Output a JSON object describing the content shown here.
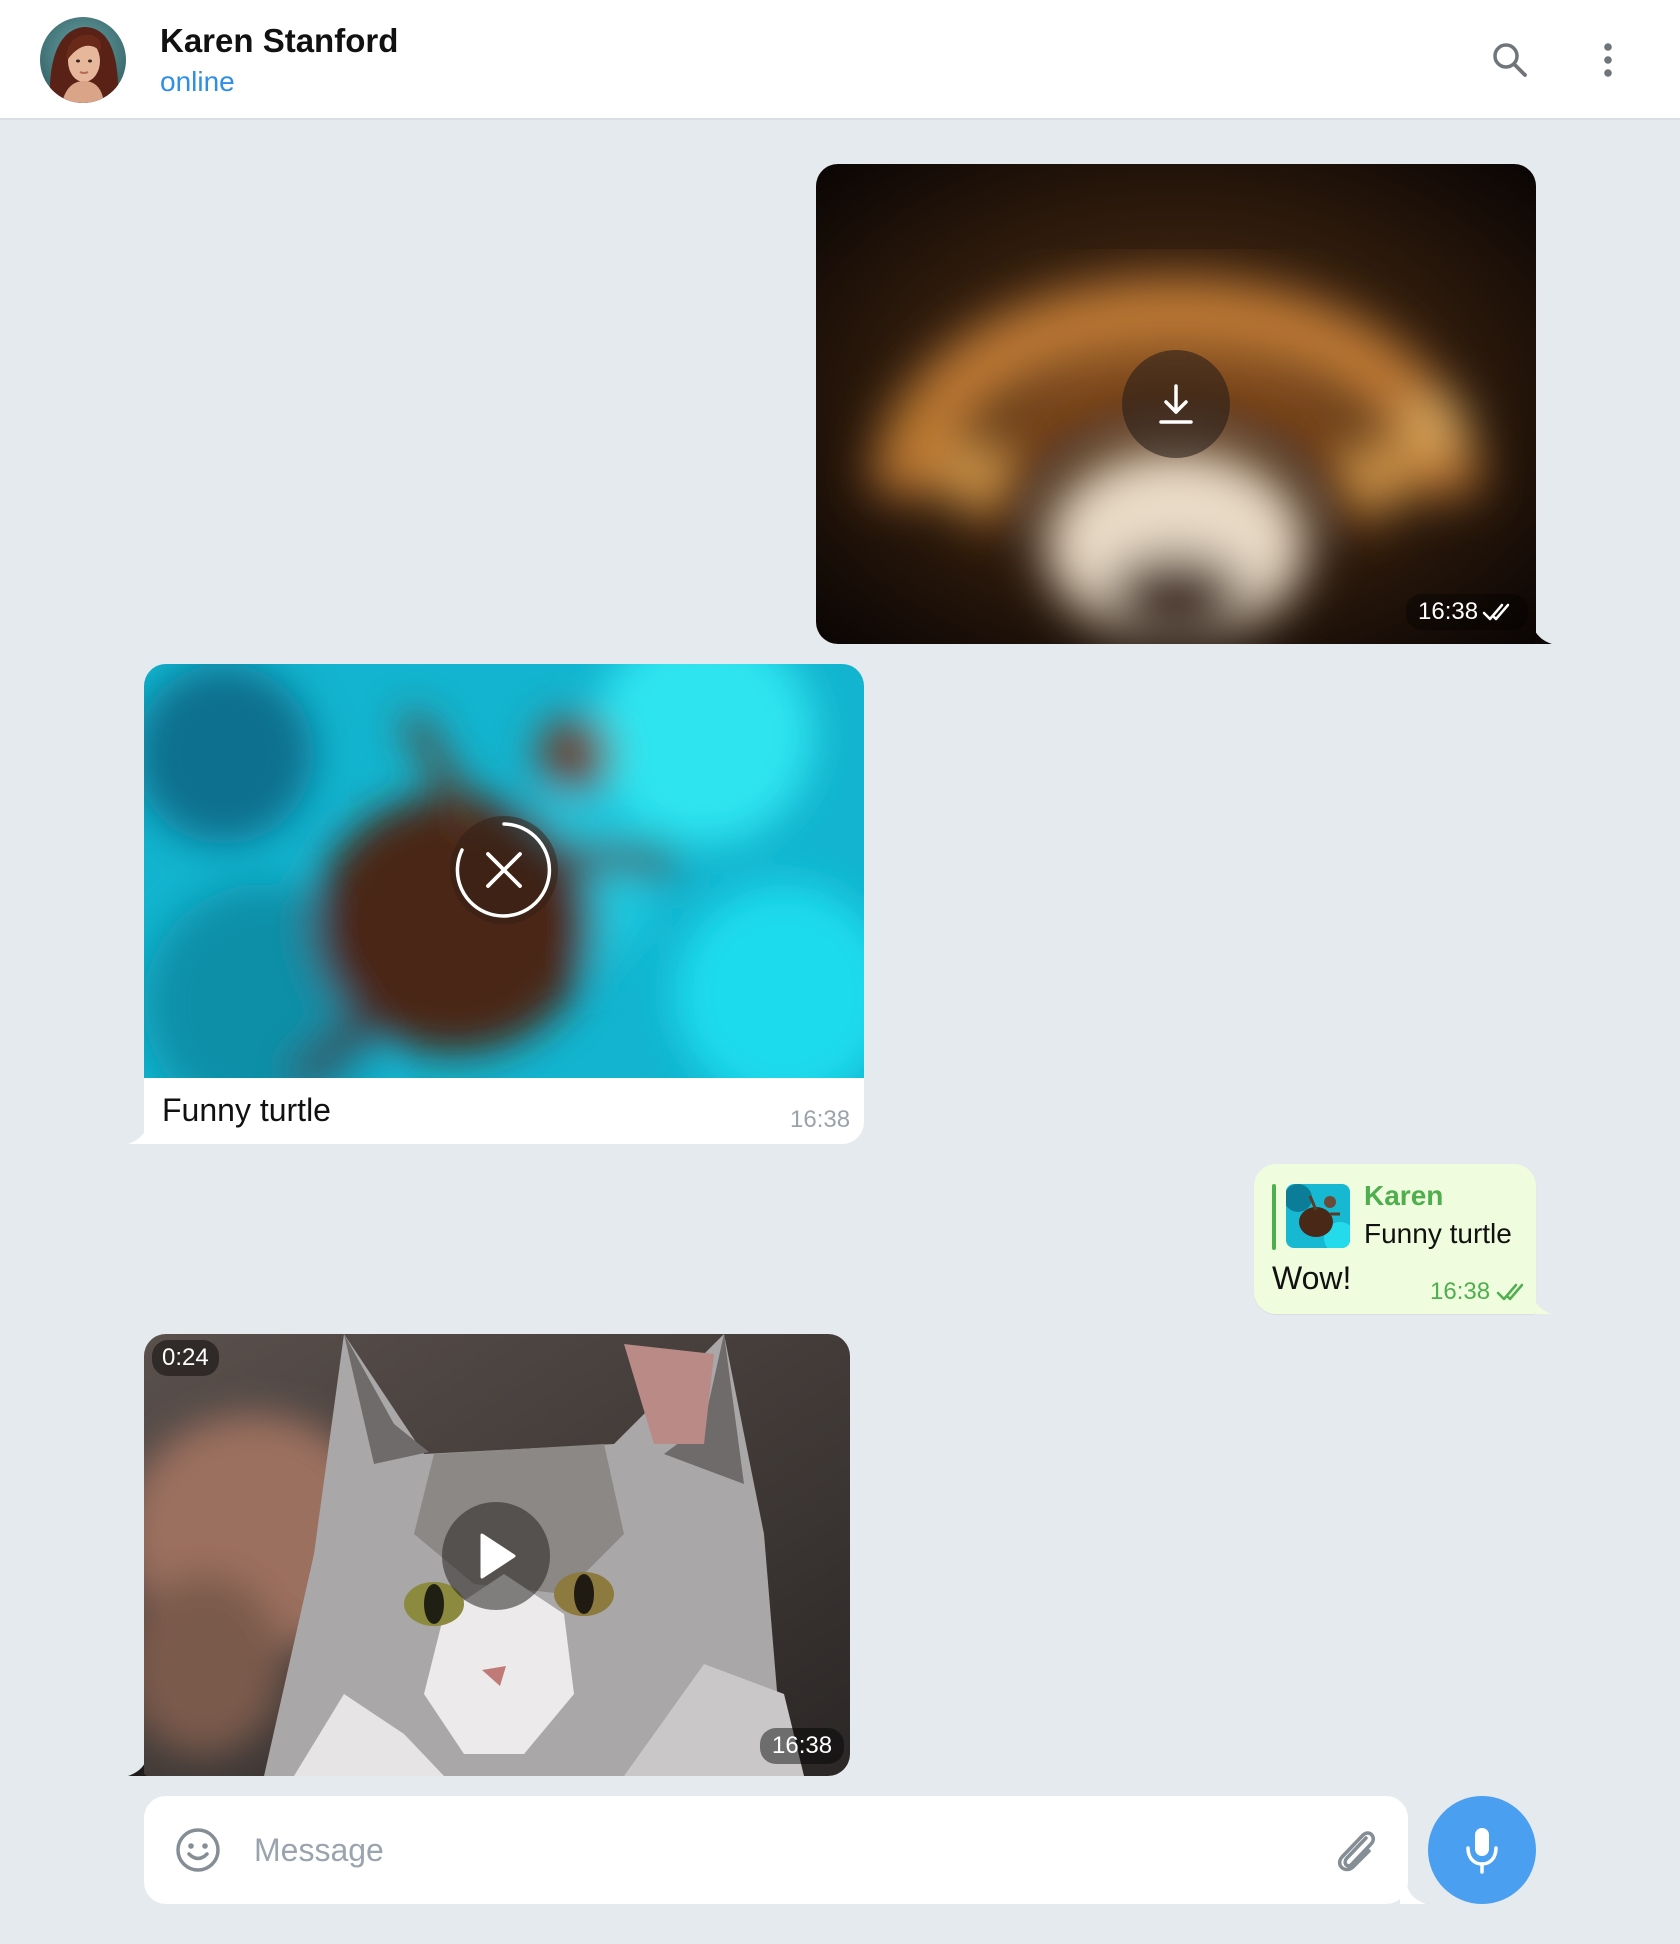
{
  "header": {
    "contact_name": "Karen Stanford",
    "status": "online",
    "icons": [
      "search-icon",
      "more-vertical-icon"
    ]
  },
  "messages": [
    {
      "id": "m1",
      "direction": "outgoing",
      "kind": "photo",
      "time": "16:38",
      "read": true,
      "overlay_icon": "download-icon"
    },
    {
      "id": "m2",
      "direction": "incoming",
      "kind": "photo",
      "caption": "Funny turtle",
      "time": "16:38",
      "overlay_icon": "cancel-icon"
    },
    {
      "id": "m3",
      "direction": "outgoing",
      "kind": "text",
      "reply_to": {
        "author": "Karen",
        "text": "Funny turtle"
      },
      "text": "Wow!",
      "time": "16:38",
      "read": true
    },
    {
      "id": "m4",
      "direction": "incoming",
      "kind": "video",
      "duration": "0:24",
      "time": "16:38",
      "overlay_icon": "play-icon"
    }
  ],
  "composer": {
    "placeholder": "Message",
    "icons": [
      "emoji-icon",
      "attach-icon",
      "microphone-icon"
    ]
  },
  "colors": {
    "background": "#e5eaee",
    "accent": "#4a9ff0",
    "status_online": "#2f8ee6",
    "outgoing_bubble": "#effdde",
    "reply_green": "#4fae4e"
  }
}
